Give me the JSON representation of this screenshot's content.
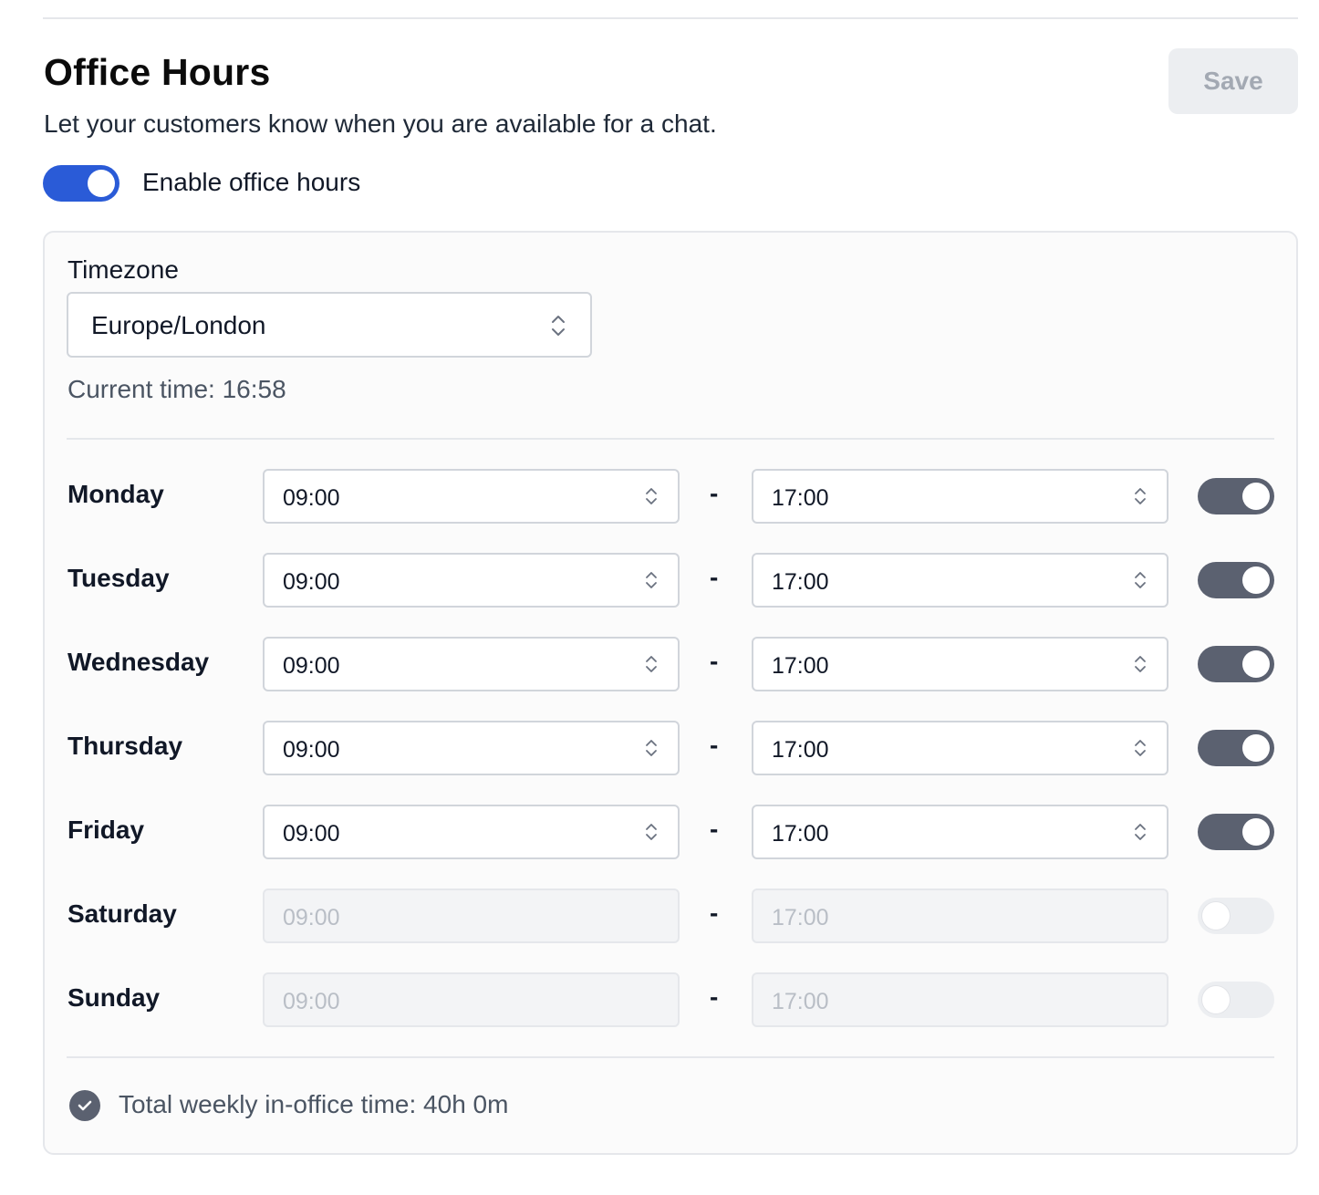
{
  "header": {
    "title": "Office Hours",
    "subtitle": "Let your customers know when you are available for a chat.",
    "save_label": "Save"
  },
  "master_toggle": {
    "label": "Enable office hours",
    "enabled": true
  },
  "timezone": {
    "label": "Timezone",
    "value": "Europe/London",
    "current_time": "Current time: 16:58"
  },
  "schedule": {
    "separator": "-",
    "days": [
      {
        "name": "Monday",
        "start": "09:00",
        "end": "17:00",
        "enabled": true
      },
      {
        "name": "Tuesday",
        "start": "09:00",
        "end": "17:00",
        "enabled": true
      },
      {
        "name": "Wednesday",
        "start": "09:00",
        "end": "17:00",
        "enabled": true
      },
      {
        "name": "Thursday",
        "start": "09:00",
        "end": "17:00",
        "enabled": true
      },
      {
        "name": "Friday",
        "start": "09:00",
        "end": "17:00",
        "enabled": true
      },
      {
        "name": "Saturday",
        "start": "09:00",
        "end": "17:00",
        "enabled": false
      },
      {
        "name": "Sunday",
        "start": "09:00",
        "end": "17:00",
        "enabled": false
      }
    ]
  },
  "footer": {
    "total": "Total weekly in-office time: 40h 0m",
    "icon": "check-circle-icon"
  },
  "colors": {
    "accent": "#2a5bd7",
    "toggle_on": "#5b6170",
    "toggle_off": "#eceef1",
    "save_disabled_bg": "#eceef1"
  }
}
